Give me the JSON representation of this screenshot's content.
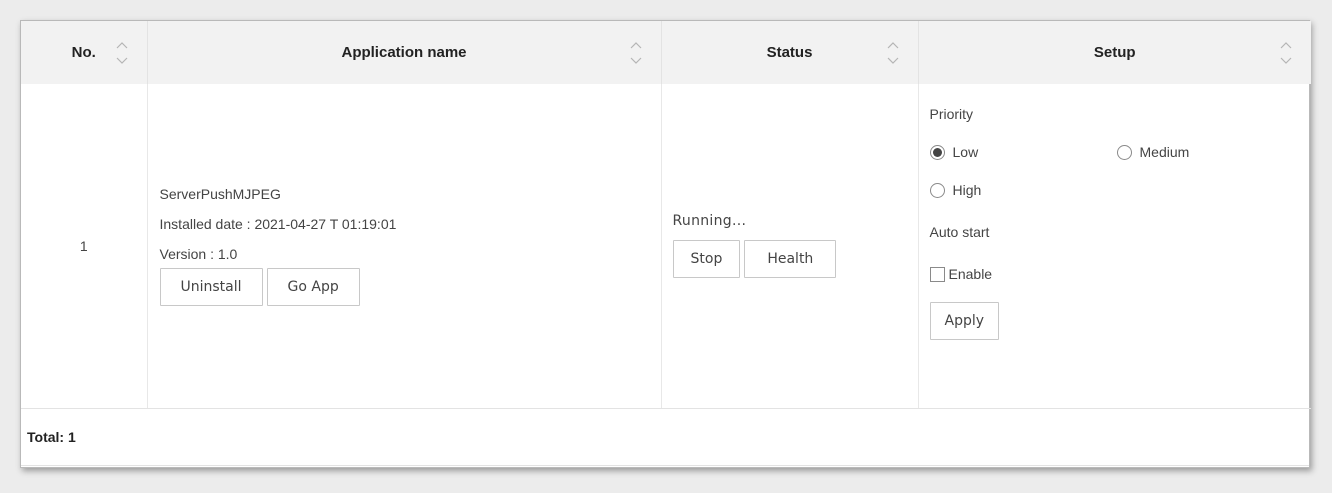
{
  "table": {
    "columns": [
      {
        "label": "No."
      },
      {
        "label": "Application name"
      },
      {
        "label": "Status"
      },
      {
        "label": "Setup"
      }
    ],
    "rows": [
      {
        "no": "1",
        "app_name": "ServerPushMJPEG",
        "installed_date": "Installed date : 2021-04-27 T 01:19:01",
        "version": "Version : 1.0",
        "uninstall_label": "Uninstall",
        "go_app_label": "Go App",
        "status": "Running...",
        "stop_label": "Stop",
        "health_label": "Health",
        "setup": {
          "priority_label": "Priority",
          "priority_options": [
            "Low",
            "Medium",
            "High"
          ],
          "priority_selected": "Low",
          "auto_start_label": "Auto start",
          "enable_label": "Enable",
          "enable_checked": false,
          "apply_label": "Apply"
        }
      }
    ]
  },
  "footer": {
    "total": "Total: 1"
  }
}
